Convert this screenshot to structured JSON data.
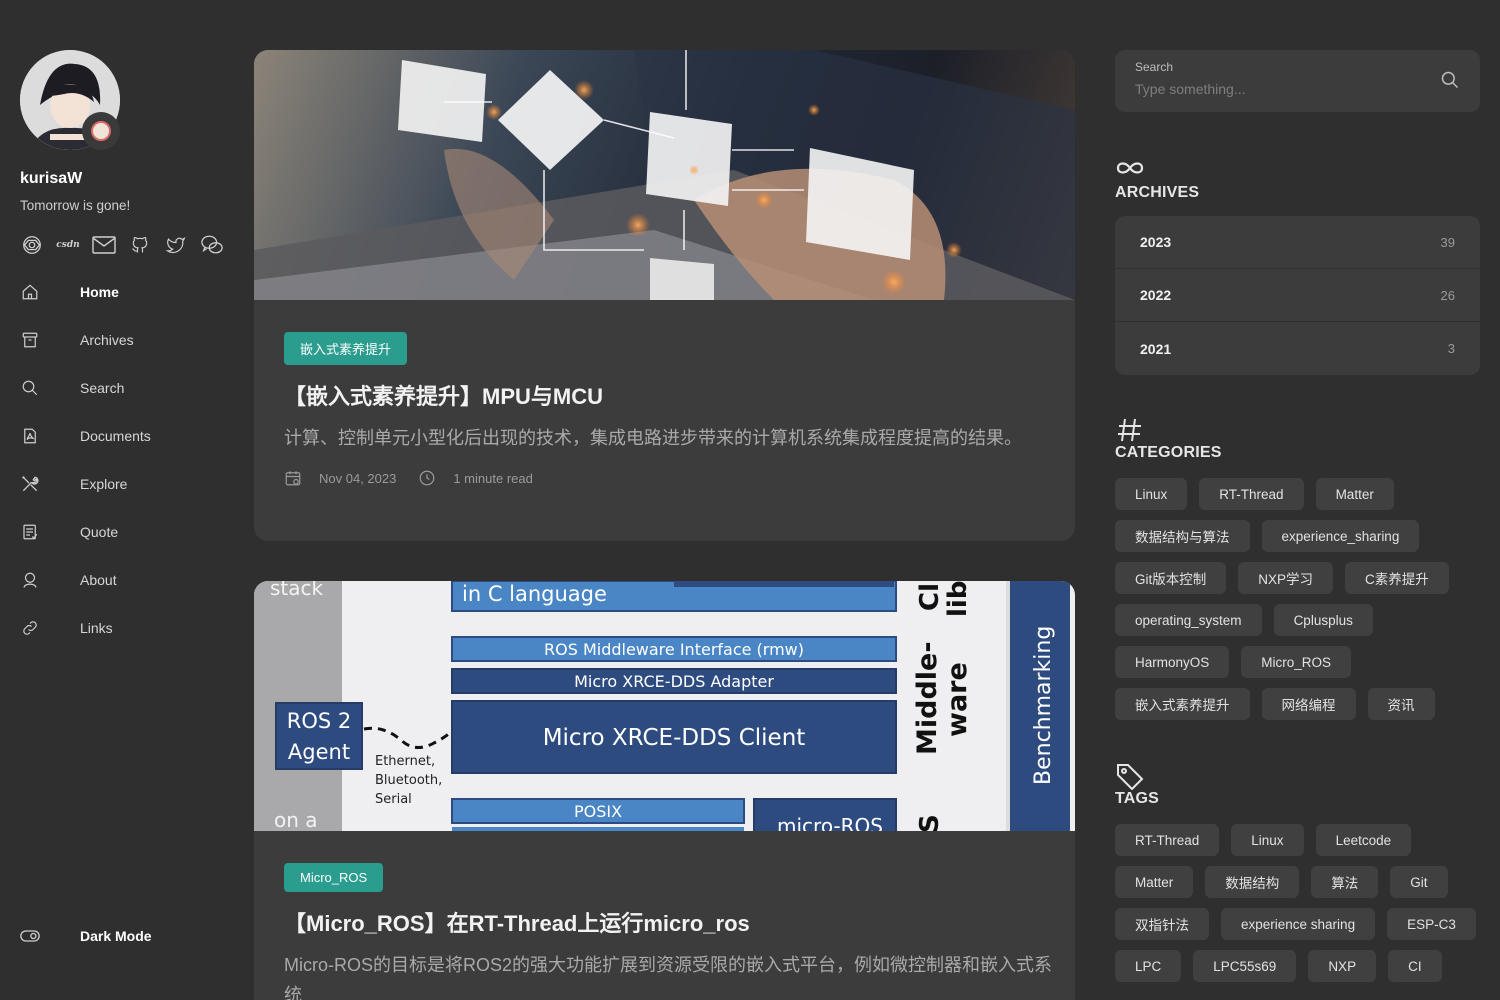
{
  "profile": {
    "name": "kurisaW",
    "tagline": "Tomorrow is gone!"
  },
  "socials": [
    {
      "icon": "openai-icon"
    },
    {
      "icon": "csdn-icon",
      "text": "csdn"
    },
    {
      "icon": "mail-icon"
    },
    {
      "icon": "github-icon"
    },
    {
      "icon": "twitter-icon"
    },
    {
      "icon": "wechat-icon"
    }
  ],
  "nav": [
    {
      "label": "Home",
      "icon": "home-icon",
      "active": true
    },
    {
      "label": "Archives",
      "icon": "archive-icon"
    },
    {
      "label": "Search",
      "icon": "search-icon"
    },
    {
      "label": "Documents",
      "icon": "document-icon"
    },
    {
      "label": "Explore",
      "icon": "tools-icon"
    },
    {
      "label": "Quote",
      "icon": "quote-icon"
    },
    {
      "label": "About",
      "icon": "user-icon"
    },
    {
      "label": "Links",
      "icon": "link-icon"
    }
  ],
  "dark_mode": {
    "label": "Dark Mode"
  },
  "posts": [
    {
      "category": "嵌入式素养提升",
      "title": "【嵌入式素养提升】MPU与MCU",
      "excerpt": "计算、控制单元小型化后出现的技术，集成电路进步带来的计算机系统集成程度提高的结果。",
      "date": "Nov 04, 2023",
      "read_time": "1 minute read"
    },
    {
      "category": "Micro_ROS",
      "title": "【Micro_ROS】在RT-Thread上运行micro_ros",
      "excerpt": "Micro-ROS的目标是将ROS2的强大功能扩展到资源受限的嵌入式平台，例如微控制器和嵌入式系统",
      "cover_labels": {
        "stack": "stack",
        "clang": "in C language",
        "rmw": "ROS Middleware Interface (rmw)",
        "adapter": "Micro XRCE-DDS Adapter",
        "client": "Micro XRCE-DDS Client",
        "agent_line1": "ROS 2",
        "agent_line2": "Agent",
        "link_line1": "Ethernet,",
        "link_line2": "Bluetooth,",
        "link_line3": "Serial",
        "posix": "POSIX",
        "ona": "on a",
        "middle1": "Middle-",
        "middle2": "ware",
        "cli": "Cli",
        "lib": "lib",
        "bench": "Benchmarking",
        "ros_partial": "micro-ROS",
        "s_partial": "S"
      }
    }
  ],
  "search": {
    "label": "Search",
    "placeholder": "Type something..."
  },
  "archives": {
    "title": "ARCHIVES",
    "items": [
      {
        "year": "2023",
        "count": "39"
      },
      {
        "year": "2022",
        "count": "26"
      },
      {
        "year": "2021",
        "count": "3"
      }
    ]
  },
  "categories": {
    "title": "CATEGORIES",
    "items": [
      "Linux",
      "RT-Thread",
      "Matter",
      "数据结构与算法",
      "experience_sharing",
      "Git版本控制",
      "NXP学习",
      "C素养提升",
      "operating_system",
      "Cplusplus",
      "HarmonyOS",
      "Micro_ROS",
      "嵌入式素养提升",
      "网络编程",
      "资讯"
    ]
  },
  "tags": {
    "title": "TAGS",
    "items": [
      "RT-Thread",
      "Linux",
      "Leetcode",
      "Matter",
      "数据结构",
      "算法",
      "Git",
      "双指针法",
      "experience sharing",
      "ESP-C3",
      "LPC",
      "LPC55s69",
      "NXP",
      "CI"
    ]
  },
  "colors": {
    "background": "#2f2f2f",
    "card": "#3c3c3c",
    "accent": "#2a9d8f",
    "diagram_blue": "#4a86c5",
    "diagram_navy": "#2e4b80"
  }
}
